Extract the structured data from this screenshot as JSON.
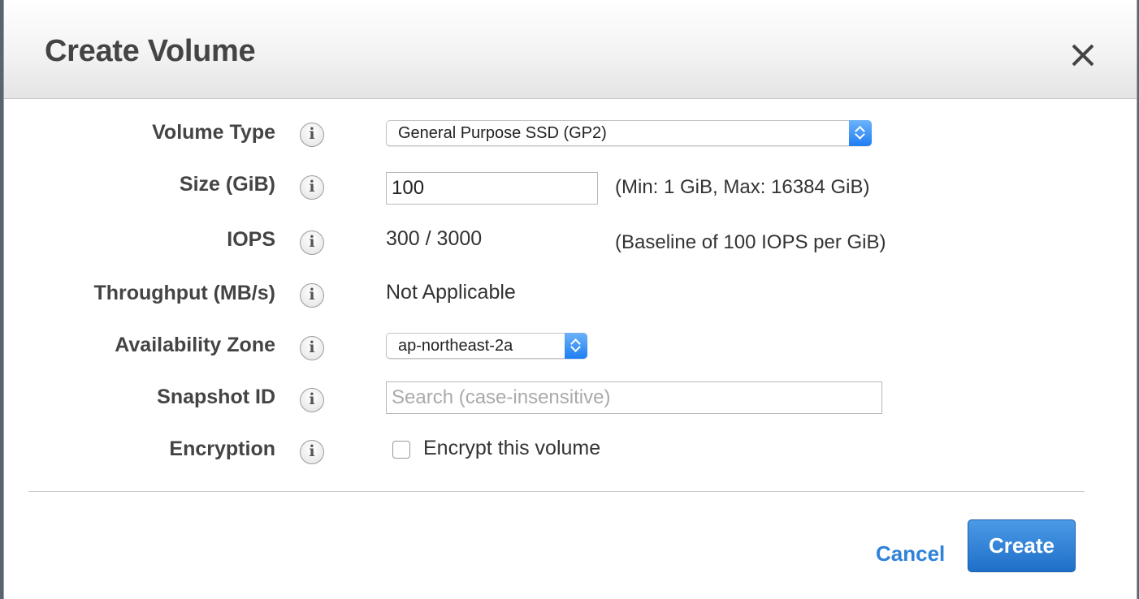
{
  "dialog": {
    "title": "Create Volume",
    "close_label": "close"
  },
  "form": {
    "volume_type": {
      "label": "Volume Type",
      "value": "General Purpose SSD (GP2)"
    },
    "size": {
      "label": "Size (GiB)",
      "value": "100",
      "hint": "(Min: 1 GiB, Max: 16384 GiB)"
    },
    "iops": {
      "label": "IOPS",
      "value": "300 / 3000",
      "hint": "(Baseline of 100 IOPS per GiB)"
    },
    "throughput": {
      "label": "Throughput (MB/s)",
      "value": "Not Applicable"
    },
    "availability_zone": {
      "label": "Availability Zone",
      "value": "ap-northeast-2a"
    },
    "snapshot_id": {
      "label": "Snapshot ID",
      "placeholder": "Search (case-insensitive)"
    },
    "encryption": {
      "label": "Encryption",
      "checkbox_label": "Encrypt this volume",
      "checked": false
    }
  },
  "info_icon_glyph": "i",
  "footer": {
    "cancel_label": "Cancel",
    "create_label": "Create"
  },
  "colors": {
    "accent": "#2f82d9",
    "primary_button": "#1f6fc9",
    "label_text": "#444444"
  }
}
